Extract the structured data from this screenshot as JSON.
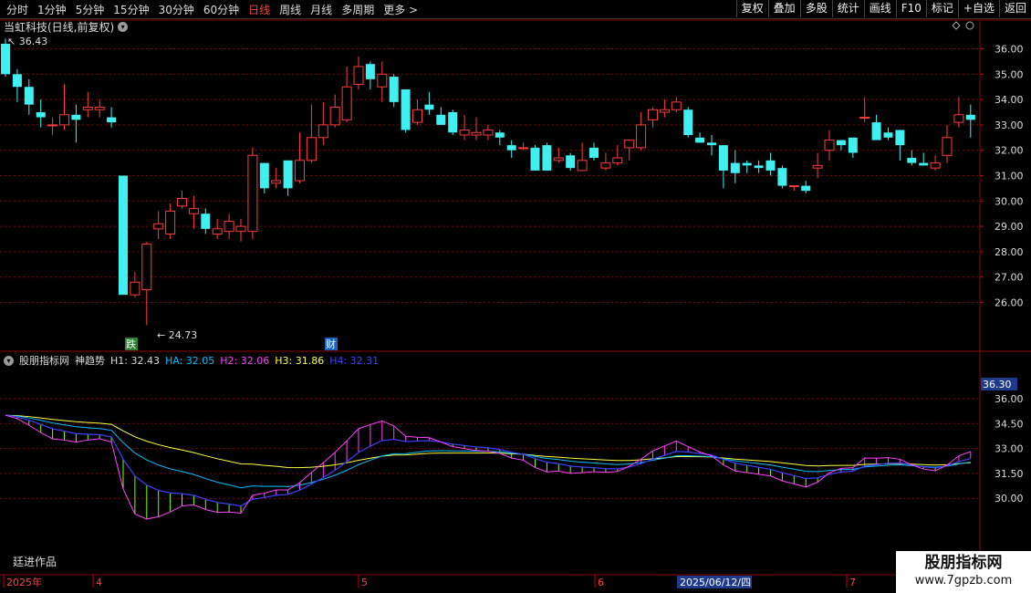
{
  "toolbar": {
    "periods": [
      "分时",
      "1分钟",
      "5分钟",
      "15分钟",
      "30分钟",
      "60分钟",
      "日线",
      "周线",
      "月线",
      "多周期",
      "更多 >"
    ],
    "active_period": "日线",
    "buttons": [
      "复权",
      "叠加",
      "多股",
      "统计",
      "画线",
      "F10",
      "标记",
      "+自选",
      "返回"
    ]
  },
  "title": "当虹科技(日线,前复权)",
  "price_axis_labels": [
    "36.00",
    "35.00",
    "34.00",
    "33.00",
    "32.00",
    "31.00",
    "30.00",
    "29.00",
    "28.00",
    "27.00",
    "26.00"
  ],
  "annotations": {
    "high": "36.43",
    "low": "24.73",
    "marker_1": "跌",
    "marker_2": "财"
  },
  "indicator": {
    "name": "股朋指标网",
    "title": "神趋势",
    "values": [
      {
        "label": "H1: 32.43",
        "color": "#dddddd"
      },
      {
        "label": "HA: 32.05",
        "color": "#00bfff"
      },
      {
        "label": "H2: 32.06",
        "color": "#ff40ff"
      },
      {
        "label": "H3: 31.86",
        "color": "#ffff40"
      },
      {
        "label": "H4: 32.31",
        "color": "#4040ff"
      }
    ],
    "axis_labels": [
      "36.00",
      "34.50",
      "33.00",
      "31.50",
      "30.00"
    ],
    "current_tag": "36.30"
  },
  "date_axis": {
    "labels": [
      "2025年",
      "4",
      "5",
      "6",
      "7"
    ],
    "highlight": "2025/06/12/四"
  },
  "author": "廷进作品",
  "watermark": {
    "line1": "股朋指标网",
    "line2": "www.7gpzb.com"
  },
  "colors": {
    "up": "#ff3c3c",
    "down": "#40f0f0",
    "grid": "#8b0000"
  },
  "chart_data": {
    "type": "candlestick",
    "ylim": [
      25.0,
      36.5
    ],
    "candles": [
      [
        36.2,
        35.0,
        36.4,
        34.9
      ],
      [
        35.0,
        34.5,
        35.2,
        33.9
      ],
      [
        34.5,
        33.8,
        34.8,
        33.4
      ],
      [
        33.5,
        33.3,
        34.0,
        32.9
      ],
      [
        33.0,
        33.0,
        33.3,
        32.6
      ],
      [
        33.0,
        33.4,
        34.6,
        32.8
      ],
      [
        33.4,
        33.2,
        33.8,
        32.3
      ],
      [
        33.6,
        33.7,
        34.3,
        33.3
      ],
      [
        33.6,
        33.7,
        34.0,
        33.3
      ],
      [
        33.3,
        33.1,
        33.7,
        32.9
      ],
      [
        31.0,
        26.3,
        31.0,
        26.3
      ],
      [
        26.3,
        26.8,
        27.2,
        26.2
      ],
      [
        26.5,
        28.3,
        28.4,
        25.1
      ],
      [
        28.9,
        29.1,
        29.6,
        28.5
      ],
      [
        28.7,
        29.6,
        29.9,
        28.5
      ],
      [
        29.8,
        30.1,
        30.4,
        29.7
      ],
      [
        29.5,
        29.7,
        30.2,
        28.9
      ],
      [
        29.5,
        28.9,
        29.7,
        28.7
      ],
      [
        28.7,
        28.9,
        29.3,
        28.5
      ],
      [
        28.8,
        29.2,
        29.5,
        28.5
      ],
      [
        28.8,
        29.0,
        29.3,
        28.4
      ],
      [
        28.8,
        31.8,
        32.1,
        28.5
      ],
      [
        31.5,
        30.5,
        31.5,
        30.3
      ],
      [
        30.7,
        30.8,
        31.3,
        30.5
      ],
      [
        31.6,
        30.5,
        31.6,
        30.2
      ],
      [
        30.8,
        31.6,
        32.7,
        30.7
      ],
      [
        31.6,
        32.5,
        33.8,
        31.5
      ],
      [
        32.5,
        33.0,
        33.9,
        32.2
      ],
      [
        33.0,
        33.7,
        34.2,
        32.9
      ],
      [
        33.2,
        34.5,
        35.3,
        33.1
      ],
      [
        34.6,
        35.3,
        35.7,
        34.4
      ],
      [
        35.4,
        34.8,
        35.5,
        34.4
      ],
      [
        34.5,
        35.0,
        35.5,
        33.9
      ],
      [
        34.9,
        33.9,
        35.0,
        33.7
      ],
      [
        34.4,
        32.8,
        34.4,
        32.7
      ],
      [
        33.1,
        33.6,
        34.0,
        33.0
      ],
      [
        33.8,
        33.6,
        34.3,
        33.4
      ],
      [
        33.4,
        33.0,
        33.7,
        33.1
      ],
      [
        33.5,
        32.7,
        33.6,
        32.6
      ],
      [
        32.6,
        32.8,
        33.4,
        32.4
      ],
      [
        32.6,
        32.7,
        33.3,
        32.4
      ],
      [
        32.6,
        32.8,
        33.0,
        32.4
      ],
      [
        32.7,
        32.5,
        32.8,
        32.2
      ],
      [
        32.2,
        32.0,
        32.4,
        31.7
      ],
      [
        32.1,
        32.1,
        32.3,
        32.0
      ],
      [
        32.1,
        31.2,
        32.2,
        31.2
      ],
      [
        32.2,
        31.2,
        32.3,
        31.2
      ],
      [
        31.6,
        31.7,
        32.1,
        31.5
      ],
      [
        31.8,
        31.3,
        31.9,
        31.2
      ],
      [
        31.2,
        31.6,
        32.3,
        31.2
      ],
      [
        32.1,
        31.7,
        32.3,
        31.6
      ],
      [
        31.3,
        31.5,
        31.9,
        31.2
      ],
      [
        31.5,
        31.7,
        32.2,
        31.4
      ],
      [
        32.1,
        32.4,
        32.4,
        31.6
      ],
      [
        32.1,
        33.0,
        33.5,
        32.0
      ],
      [
        33.2,
        33.6,
        33.7,
        32.9
      ],
      [
        33.5,
        33.6,
        34.0,
        33.3
      ],
      [
        33.6,
        33.9,
        34.1,
        33.5
      ],
      [
        33.6,
        32.6,
        33.7,
        32.5
      ],
      [
        32.5,
        32.3,
        32.7,
        32.3
      ],
      [
        32.3,
        32.2,
        32.6,
        31.8
      ],
      [
        32.2,
        31.2,
        32.2,
        30.5
      ],
      [
        31.5,
        31.1,
        32.0,
        30.7
      ],
      [
        31.5,
        31.4,
        31.6,
        31.1
      ],
      [
        31.4,
        31.3,
        31.6,
        31.1
      ],
      [
        31.6,
        31.2,
        31.9,
        31.0
      ],
      [
        31.3,
        30.6,
        31.4,
        30.5
      ],
      [
        30.6,
        30.6,
        30.6,
        30.4
      ],
      [
        30.6,
        30.4,
        30.8,
        30.3
      ],
      [
        31.3,
        31.4,
        31.9,
        30.9
      ],
      [
        32.0,
        32.4,
        32.8,
        31.6
      ],
      [
        32.4,
        32.2,
        32.4,
        32.0
      ],
      [
        32.5,
        31.9,
        32.5,
        31.7
      ],
      [
        33.3,
        33.3,
        34.1,
        33.1
      ],
      [
        33.1,
        32.4,
        33.4,
        32.4
      ],
      [
        32.7,
        32.5,
        32.9,
        32.4
      ],
      [
        32.8,
        32.2,
        32.8,
        31.6
      ],
      [
        31.7,
        31.5,
        32.0,
        31.4
      ],
      [
        31.5,
        31.4,
        31.9,
        31.4
      ],
      [
        31.3,
        31.5,
        31.8,
        31.2
      ],
      [
        31.8,
        32.5,
        33.0,
        31.5
      ],
      [
        33.1,
        33.4,
        34.1,
        32.9
      ],
      [
        33.4,
        33.2,
        33.8,
        32.5
      ]
    ]
  }
}
